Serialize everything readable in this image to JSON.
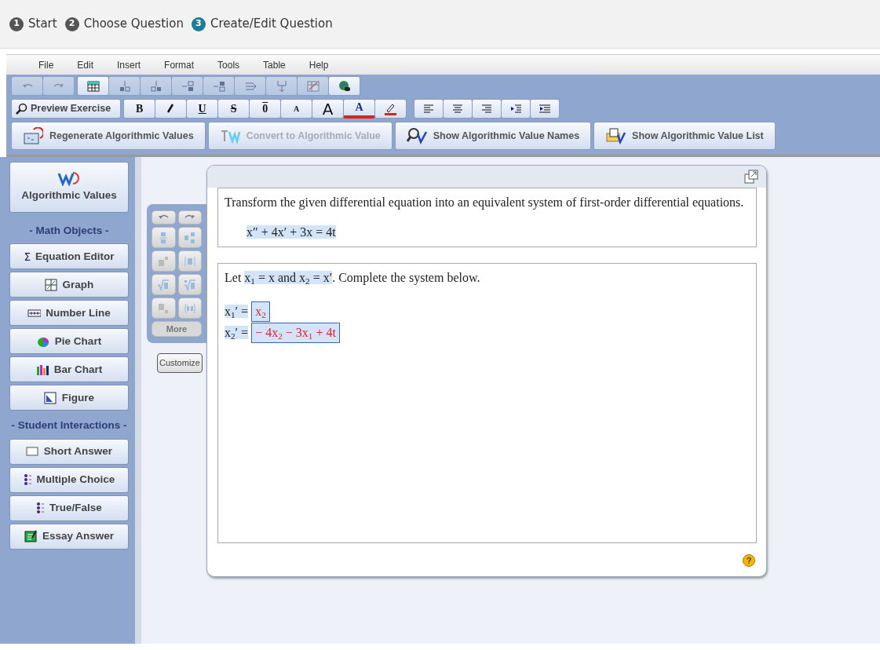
{
  "steps": [
    {
      "number": "1",
      "label": "Start",
      "selected": false
    },
    {
      "number": "2",
      "label": "Choose Question",
      "selected": false
    },
    {
      "number": "3",
      "label": "Create/Edit Question",
      "selected": true
    }
  ],
  "menu": [
    "File",
    "Edit",
    "Insert",
    "Format",
    "Tools",
    "Table",
    "Help"
  ],
  "toolbar_icons": [
    {
      "kind": "undo",
      "disabled": true
    },
    {
      "kind": "redo",
      "disabled": true
    },
    {
      "kind": "table",
      "disabled": false
    },
    {
      "kind": "row-above",
      "disabled": true
    },
    {
      "kind": "row-below",
      "disabled": true
    },
    {
      "kind": "col-left",
      "disabled": true
    },
    {
      "kind": "col-right",
      "disabled": true
    },
    {
      "kind": "col-delete",
      "disabled": true
    },
    {
      "kind": "row-delete",
      "disabled": true
    },
    {
      "kind": "table-delete",
      "disabled": true
    },
    {
      "kind": "globe",
      "disabled": false
    }
  ],
  "preview_button": "Preview Exercise",
  "format_icons": [
    {
      "kind": "bold",
      "label": "B"
    },
    {
      "kind": "italic"
    },
    {
      "kind": "underline",
      "label": "U"
    },
    {
      "kind": "strike",
      "label": "S"
    },
    {
      "kind": "overline",
      "label": "0"
    },
    {
      "kind": "smaller",
      "label": "A"
    },
    {
      "kind": "larger",
      "label": "A"
    },
    {
      "kind": "color",
      "label": "A"
    },
    {
      "kind": "highlight"
    }
  ],
  "align_icons": [
    {
      "kind": "left"
    },
    {
      "kind": "center"
    },
    {
      "kind": "right"
    },
    {
      "kind": "outdent"
    },
    {
      "kind": "indent"
    }
  ],
  "algo_buttons": [
    {
      "kind": "regenerate",
      "label": "Regenerate Algorithmic Values",
      "disabled": false
    },
    {
      "kind": "convert",
      "label": "Convert to Algorithmic Value",
      "disabled": true
    },
    {
      "kind": "names",
      "label": "Show Algorithmic Value Names",
      "disabled": false
    },
    {
      "kind": "list",
      "label": "Show Algorithmic Value List",
      "disabled": false
    }
  ],
  "sidebar": {
    "header": "Algorithmic Values",
    "sections": [
      {
        "title": "- Math Objects -",
        "items": [
          {
            "kind": "sigma",
            "symbol": "Σ",
            "label": "Equation Editor"
          },
          {
            "kind": "graph",
            "label": "Graph"
          },
          {
            "kind": "numberline",
            "label": "Number Line"
          },
          {
            "kind": "pie",
            "label": "Pie Chart"
          },
          {
            "kind": "bars",
            "label": "Bar Chart"
          },
          {
            "kind": "figure",
            "label": "Figure"
          }
        ]
      },
      {
        "title": "- Student Interactions -",
        "items": [
          {
            "kind": "shortanswer",
            "label": "Short Answer"
          },
          {
            "kind": "choice",
            "label": "Multiple Choice"
          },
          {
            "kind": "choice",
            "label": "True/False"
          },
          {
            "kind": "essay",
            "label": "Essay Answer"
          }
        ]
      }
    ]
  },
  "palette": {
    "icons": [
      {
        "kind": "undo"
      },
      {
        "kind": "redo"
      },
      {
        "kind": "fraction"
      },
      {
        "kind": "mixed"
      },
      {
        "kind": "power"
      },
      {
        "kind": "abs"
      },
      {
        "kind": "sqrt"
      },
      {
        "kind": "root"
      },
      {
        "kind": "subscript"
      },
      {
        "kind": "pair"
      }
    ],
    "more": "More",
    "customize": "Customize"
  },
  "question": {
    "prompt": "Transform the given differential equation into an equivalent system of first-order differential equations.",
    "equation": "x″ + 4x′ + 3x = 4t",
    "intro": [
      {
        "text": "Let ",
        "math": false
      },
      {
        "text": "x$_{1}$ = x and x$_{2}$ = x′",
        "math": true
      },
      {
        "text": ". Complete the system below.",
        "math": false
      }
    ],
    "answers": [
      {
        "label": "x$_{1}$′ =",
        "answer": "x$_{2}$"
      },
      {
        "label": "x$_{2}$′ =",
        "answer": "− 4x$_{2}$ − 3x$_{1}$ + 4t"
      }
    ],
    "help": "?"
  }
}
